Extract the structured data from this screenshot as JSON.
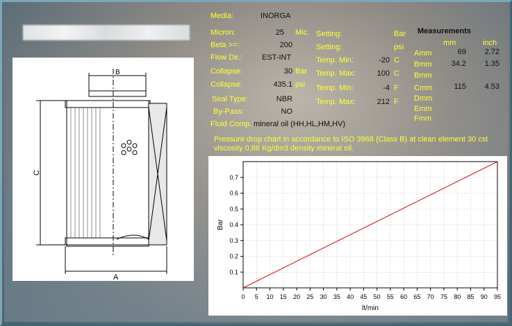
{
  "fields": {
    "media": {
      "label": "Media:",
      "value": "INORGA"
    },
    "micron": {
      "label": "Micron:",
      "value": "25",
      "unit": "Mic."
    },
    "beta": {
      "label": "Beta >=:",
      "value": "200"
    },
    "flow_dir": {
      "label": "Flow Dir.:",
      "value": "EST-INT"
    },
    "collapse_bar": {
      "label": "Collapse:",
      "value": "30",
      "unit": "Bar"
    },
    "collapse_psi": {
      "label": "Collapse:",
      "value": "435.1",
      "unit": "psi"
    },
    "seal_type": {
      "label": "Seal Type:",
      "value": "NBR"
    },
    "by_pass": {
      "label": "By-Pass:",
      "value": "NO"
    },
    "fluid_comp": {
      "label": "Fluid Comp.:",
      "value": "mineral oil (HH,HL,HM,HV)"
    }
  },
  "settings": {
    "setting_bar": {
      "label": "Setting:",
      "value": "",
      "unit": "Bar"
    },
    "setting_psi": {
      "label": "Setting:",
      "value": "",
      "unit": "psi"
    },
    "temp_min_c": {
      "label": "Temp. Min:",
      "value": "-20",
      "unit": "C"
    },
    "temp_max_c": {
      "label": "Temp. Max:",
      "value": "100",
      "unit": "C"
    },
    "temp_min_f": {
      "label": "Temp. Min:",
      "value": "-4",
      "unit": "F"
    },
    "temp_max_f": {
      "label": "Temp. Max:",
      "value": "212",
      "unit": "F"
    }
  },
  "measurements": {
    "title": "Measurements",
    "col_mm": "mm",
    "col_inch": "inch",
    "rows": [
      {
        "label": "Amm",
        "mm": "69",
        "inch": "2.72"
      },
      {
        "label": "Bmm",
        "mm": "34.2",
        "inch": "1.35"
      },
      {
        "label": "Bmm",
        "mm": "",
        "inch": ""
      },
      {
        "label": "Cmm",
        "mm": "115",
        "inch": "4.53"
      },
      {
        "label": "Dmm",
        "mm": "",
        "inch": ""
      },
      {
        "label": "Emm",
        "mm": "",
        "inch": ""
      },
      {
        "label": "Fmm",
        "mm": "",
        "inch": ""
      }
    ]
  },
  "note": "Pressure drop chart in accordance to ISO 3968 (Class B) at clean element 30 cst viscosity 0,86 Kg/dm3 density mineral oil.",
  "drawing": {
    "label_b": "B",
    "label_c": "C",
    "label_a": "A"
  },
  "colors": {
    "label_yellow": "#ffff33",
    "line_red": "#dd0000"
  },
  "chart_data": {
    "type": "line",
    "xlabel": "lt/min",
    "ylabel": "Bar",
    "xlim": [
      0,
      95
    ],
    "ylim": [
      0,
      0.8
    ],
    "xticks": [
      0,
      5,
      10,
      15,
      20,
      25,
      30,
      35,
      40,
      45,
      50,
      55,
      60,
      65,
      70,
      75,
      80,
      85,
      90,
      95
    ],
    "yticks": [
      0.1,
      0.2,
      0.3,
      0.4,
      0.5,
      0.6,
      0.7
    ],
    "grid": true,
    "series": [
      {
        "x": [
          0,
          95
        ],
        "y": [
          0,
          0.8
        ]
      }
    ]
  }
}
